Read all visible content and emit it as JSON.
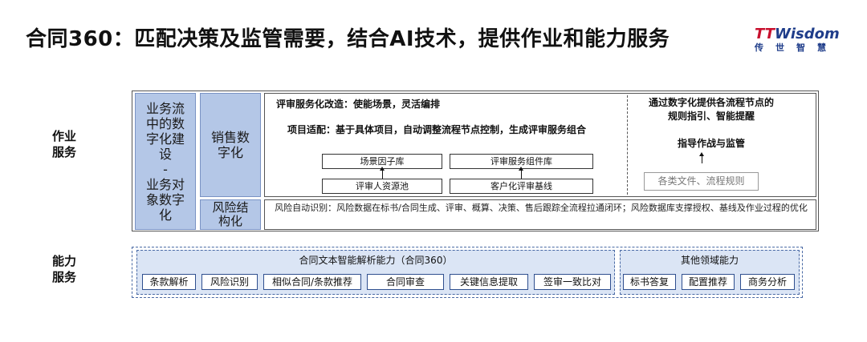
{
  "title": "合同360：匹配决策及监管需要，结合AI技术，提供作业和能力服务",
  "logo": {
    "top_tt": "TT",
    "top_rest": "Wisdom",
    "sub": "传世智慧"
  },
  "sections": {
    "work": "作业\n服务",
    "capability": "能力\n服务"
  },
  "left_block": "业务流\n中的数\n字化建\n设\n-\n业务对\n象数字\n化",
  "sales_block": "销售数\n字化",
  "risk_block": "风险结\n构化",
  "review": {
    "line1": "评审服务化改造：使能场景，灵活编排",
    "line2": "项目适配：基于具体项目，自动调整流程节点控制，生成评审服务组合",
    "boxes": [
      "场景因子库",
      "评审服务组件库",
      "评审人资源池",
      "客户化评审基线"
    ]
  },
  "guide": {
    "line1": "通过数字化提供各流程节点的\n规则指引、智能提醒",
    "line2": "指导作战与监管",
    "box": "各类文件、流程规则"
  },
  "risk_text": "风险自动识别：风险数据在标书/合同生成、评审、概算、决策、售后跟踪全流程拉通闭环；风险数据库支撑授权、基线及作业过程的优化",
  "capabilities": {
    "group1_title": "合同文本智能解析能力（合同360）",
    "group1_items": [
      "条款解析",
      "风险识别",
      "相似合同/条款推荐",
      "合同审查",
      "关键信息提取",
      "签审一致比对"
    ],
    "group2_title": "其他领域能力",
    "group2_items": [
      "标书答复",
      "配置推荐",
      "商务分析"
    ]
  }
}
